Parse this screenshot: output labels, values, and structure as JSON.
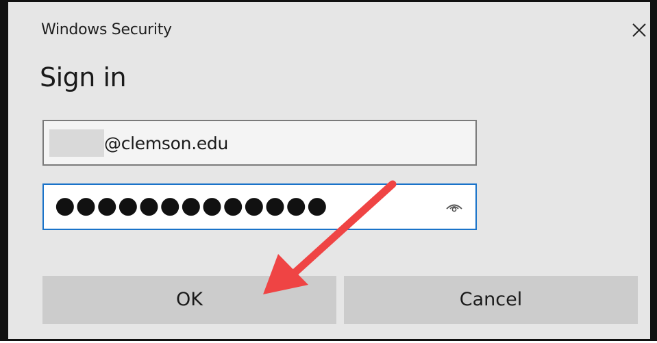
{
  "window": {
    "title": "Windows Security"
  },
  "dialog": {
    "heading": "Sign in"
  },
  "username_field": {
    "value": "@clemson.edu"
  },
  "password_field": {
    "value": "●●●●●●●●●●●●●"
  },
  "buttons": {
    "ok_label": "OK",
    "cancel_label": "Cancel"
  },
  "icons": {
    "close": "close-icon",
    "reveal": "eye-icon",
    "annotation": "red-arrow-annotation"
  },
  "colors": {
    "background": "#e6e6e6",
    "focus_border": "#1a73c9",
    "button_bg": "#cccccc",
    "arrow": "#ef4444"
  }
}
